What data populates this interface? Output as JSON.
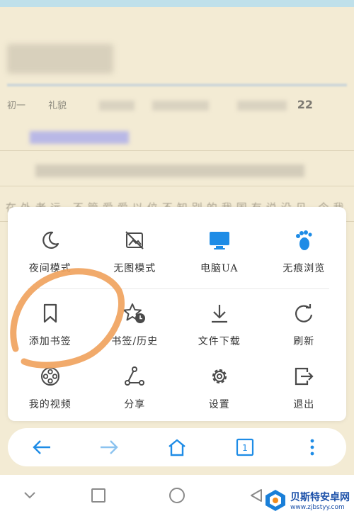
{
  "reader": {
    "meta_label_1": "初一",
    "meta_label_2": "礼貌",
    "meta_number": "22",
    "body_line": "在外老远 不管爱爱以位不知别的我国有说没见 今我"
  },
  "menu": {
    "rows": [
      [
        {
          "label": "夜间模式",
          "icon": "moon-icon"
        },
        {
          "label": "无图模式",
          "icon": "no-image-icon"
        },
        {
          "label": "电脑UA",
          "icon": "desktop-monitor-icon"
        },
        {
          "label": "无痕浏览",
          "icon": "footprint-icon"
        }
      ],
      [
        {
          "label": "添加书签",
          "icon": "bookmark-icon"
        },
        {
          "label": "书签/历史",
          "icon": "star-clock-icon"
        },
        {
          "label": "文件下载",
          "icon": "download-icon"
        },
        {
          "label": "刷新",
          "icon": "refresh-icon"
        }
      ],
      [
        {
          "label": "我的视频",
          "icon": "film-reel-icon"
        },
        {
          "label": "分享",
          "icon": "share-icon"
        },
        {
          "label": "设置",
          "icon": "gear-icon"
        },
        {
          "label": "退出",
          "icon": "exit-icon"
        }
      ]
    ]
  },
  "toolbar": {
    "items": [
      "back-arrow-icon",
      "forward-arrow-icon",
      "home-icon",
      "tabs-icon",
      "more-menu-icon"
    ],
    "tab_count": "1"
  },
  "watermark": {
    "name": "贝斯特安卓网",
    "url": "www.zjbstyy.com"
  },
  "colors": {
    "accent": "#1e8ce6",
    "accent_light": "#8cc3ef",
    "icon_gray": "#4a4a4a",
    "annotation": "#f0a35e",
    "page_bg": "#f3ebd4"
  }
}
